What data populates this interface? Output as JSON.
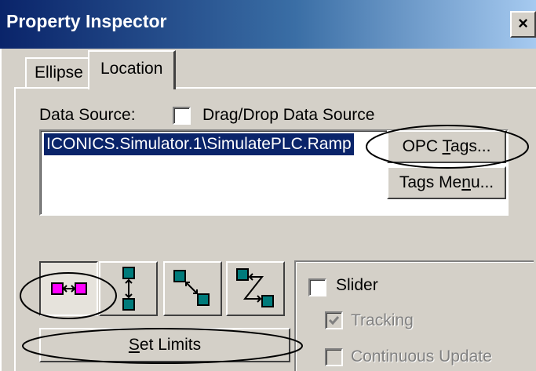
{
  "window": {
    "title": "Property Inspector",
    "close_glyph": "×"
  },
  "tabs": [
    {
      "label": "Ellipse",
      "selected": false
    },
    {
      "label": "Location",
      "selected": true
    }
  ],
  "data_source": {
    "label": "Data Source:",
    "drag_drop_label": "Drag/Drop Data Source",
    "drag_drop_checked": false,
    "items": [
      "ICONICS.Simulator.1\\SimulatePLC.Ramp"
    ],
    "selected_index": 0
  },
  "buttons": {
    "opc_tags": {
      "prefix": "OPC ",
      "mnemonic": "T",
      "suffix": "ags..."
    },
    "tags_menu": {
      "prefix": "Tags Me",
      "mnemonic": "n",
      "suffix": "u..."
    },
    "set_limits": {
      "prefix": "",
      "mnemonic": "S",
      "suffix": "et Limits"
    }
  },
  "mode_buttons": [
    {
      "icon": "horizontal-move-icon",
      "pressed": true
    },
    {
      "icon": "vertical-move-icon",
      "pressed": false
    },
    {
      "icon": "diagonal-down-move-icon",
      "pressed": false
    },
    {
      "icon": "zigzag-move-icon",
      "pressed": false
    }
  ],
  "slider_group": {
    "slider_label": "Slider",
    "slider_checked": false,
    "tracking_label": "Tracking",
    "tracking_checked": true,
    "tracking_enabled": false,
    "continuous_label": "Continuous Update",
    "continuous_checked": false,
    "continuous_enabled": false
  },
  "colors": {
    "title_start": "#0a246a",
    "title_end": "#a6caf0",
    "face": "#d4d0c8",
    "icon_teal": "#007b7b",
    "icon_magenta": "#ff00ff"
  }
}
